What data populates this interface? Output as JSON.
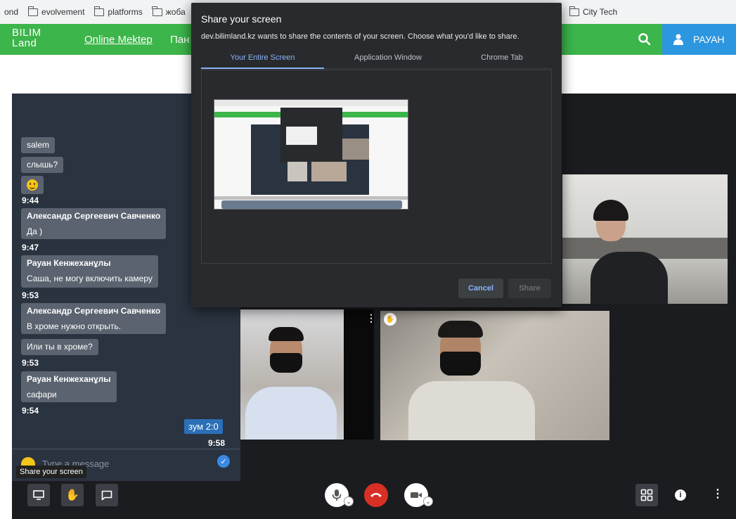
{
  "bookmarks": [
    {
      "label": "ond"
    },
    {
      "label": "evolvement"
    },
    {
      "label": "platforms"
    },
    {
      "label": "жоба"
    },
    {
      "label": "City Tech"
    }
  ],
  "site": {
    "logo_line1": "BILIM",
    "logo_line2": "Land",
    "nav_online": "Online Mektep",
    "nav_partial": "Пан",
    "user_name": "РАУАН",
    "brand_color": "#3cb54a",
    "user_color": "#2d96e0"
  },
  "chat": {
    "messages": [
      {
        "text": "salem"
      },
      {
        "text": "слышь?"
      },
      {
        "emoji": "smiley"
      },
      {
        "time": "9:44"
      },
      {
        "name": "Александр Сергеевич Савченко",
        "text": "Да )"
      },
      {
        "time": "9:47"
      },
      {
        "name": "Рауан Кенжеханұлы",
        "text": "Саша, не могу включить камеру"
      },
      {
        "time": "9:53"
      },
      {
        "name": "Александр Сергеевич Савченко",
        "text": "В хроме нужно открыть."
      },
      {
        "text": "Или ты в хроме?"
      },
      {
        "time": "9:53"
      },
      {
        "name": "Рауан Кенжеханұлы",
        "text": "сафари"
      },
      {
        "time": "9:54"
      }
    ],
    "zoom_text": "зум 2:0",
    "zoom_time": "9:58",
    "input_placeholder": "Type a message",
    "tooltip": "Share your screen"
  },
  "dialog": {
    "title": "Share your screen",
    "subtitle": "dev.bilimland.kz wants to share the contents of your screen. Choose what you'd like to share.",
    "tabs": [
      "Your Entire Screen",
      "Application Window",
      "Chrome Tab"
    ],
    "active_tab": "Your Entire Screen",
    "cancel_label": "Cancel",
    "share_label": "Share"
  },
  "toolbar": {
    "left": [
      "screen-share-icon",
      "raise-hand-icon",
      "chat-icon"
    ],
    "center": [
      "microphone-icon",
      "hang-up-icon",
      "camera-icon"
    ],
    "right": [
      "grid-view-icon",
      "info-icon",
      "more-icon"
    ],
    "hangup_color": "#d93025"
  }
}
